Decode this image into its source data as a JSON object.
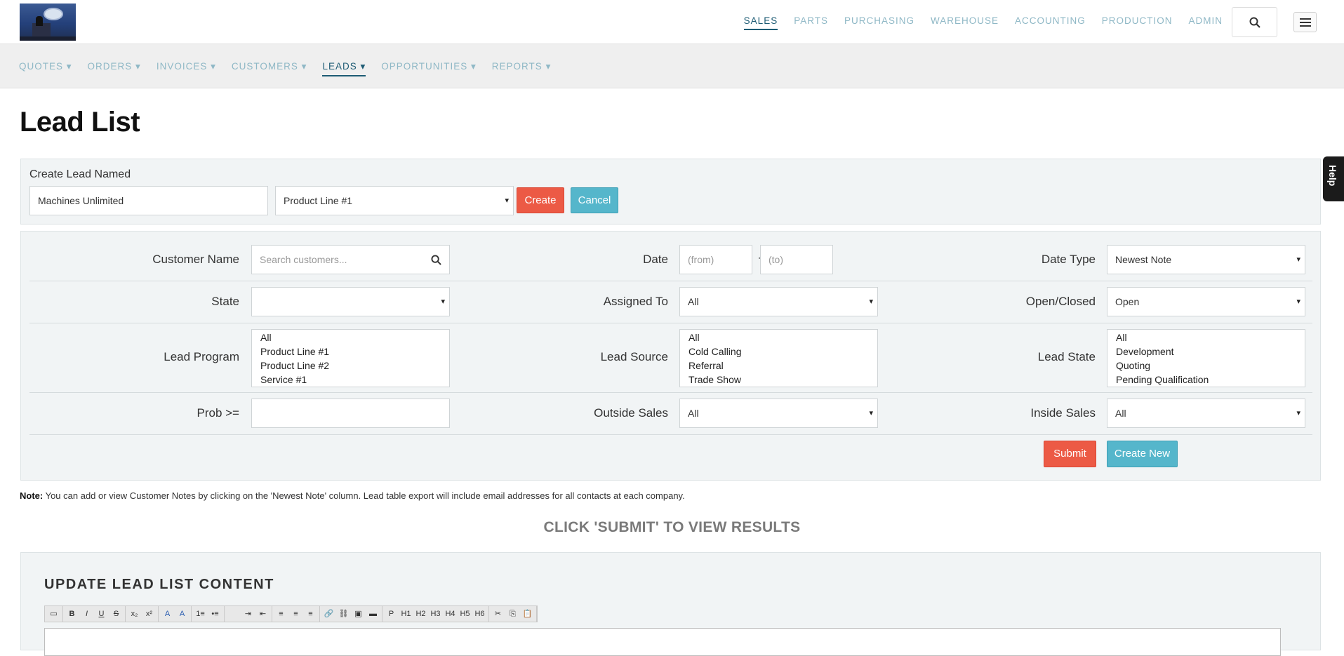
{
  "topnav": {
    "items": [
      "SALES",
      "PARTS",
      "PURCHASING",
      "WAREHOUSE",
      "ACCOUNTING",
      "PRODUCTION",
      "ADMIN"
    ],
    "active": "SALES"
  },
  "subnav": {
    "items": [
      "QUOTES ▾",
      "ORDERS ▾",
      "INVOICES ▾",
      "CUSTOMERS ▾",
      "LEADS ▾",
      "OPPORTUNITIES ▾",
      "REPORTS ▾"
    ],
    "active": "LEADS ▾"
  },
  "page_title": "Lead List",
  "help_tab": "Help",
  "create_lead": {
    "label": "Create Lead Named",
    "name_value": "Machines Unlimited",
    "program_value": "Product Line #1",
    "create_button": "Create",
    "cancel_button": "Cancel"
  },
  "filters": {
    "customer_name_label": "Customer Name",
    "customer_search_placeholder": "Search customers...",
    "date_label": "Date",
    "date_from_placeholder": "(from)",
    "date_sep": "-",
    "date_to_placeholder": "(to)",
    "date_type_label": "Date Type",
    "date_type_value": "Newest Note",
    "state_label": "State",
    "state_value": "",
    "assigned_to_label": "Assigned To",
    "assigned_to_value": "All",
    "open_closed_label": "Open/Closed",
    "open_closed_value": "Open",
    "lead_program_label": "Lead Program",
    "lead_program_options": [
      "All",
      "Product Line #1",
      "Product Line #2",
      "Service #1"
    ],
    "lead_source_label": "Lead Source",
    "lead_source_options": [
      "All",
      "Cold Calling",
      "Referral",
      "Trade Show"
    ],
    "lead_state_label": "Lead State",
    "lead_state_options": [
      "All",
      "Development",
      "Quoting",
      "Pending Qualification"
    ],
    "prob_label": "Prob >=",
    "prob_value": "",
    "outside_sales_label": "Outside Sales",
    "outside_sales_value": "All",
    "inside_sales_label": "Inside Sales",
    "inside_sales_value": "All",
    "submit_button": "Submit",
    "create_new_button": "Create New"
  },
  "note": {
    "label": "Note:",
    "text": " You can add or view Customer Notes by clicking on the 'Newest Note' column. Lead table export will include email addresses for all contacts at each company."
  },
  "click_message": "CLICK 'SUBMIT' TO VIEW RESULTS",
  "update_section": {
    "title": "UPDATE LEAD LIST CONTENT",
    "toolbar_groups": [
      [
        "▭"
      ],
      [
        "B",
        "I",
        "U",
        "S"
      ],
      [
        "x₂",
        "x²"
      ],
      [
        "A",
        "A"
      ],
      [
        "1≡",
        "•≡"
      ],
      [
        "",
        "⇥",
        "⇤"
      ],
      [
        "≡",
        "≡",
        "≡"
      ],
      [
        "🔗",
        "⛓",
        "▣",
        "▬"
      ],
      [
        "P",
        "H1",
        "H2",
        "H3",
        "H4",
        "H5",
        "H6"
      ],
      [
        "✂",
        "⎘",
        "📋"
      ]
    ]
  }
}
